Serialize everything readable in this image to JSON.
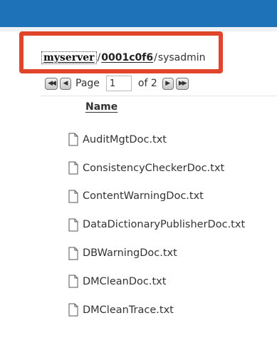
{
  "breadcrumb": {
    "server": "myserver",
    "separator": "/",
    "folder": "0001c0f6",
    "current": "sysadmin"
  },
  "pager": {
    "page_label": "Page",
    "page_value": "1",
    "of_text": "of 2"
  },
  "table": {
    "column_header": "Name",
    "files": [
      "AuditMgtDoc.txt",
      "ConsistencyCheckerDoc.txt",
      "ContentWarningDoc.txt",
      "DataDictionaryPublisherDoc.txt",
      "DBWarningDoc.txt",
      "DMCleanDoc.txt",
      "DMCleanTrace.txt"
    ]
  },
  "colors": {
    "header_bar": "#1d72b8",
    "highlight_border": "#e0452b"
  },
  "icons": {
    "first": "first-page-icon",
    "prev": "previous-page-icon",
    "next": "next-page-icon",
    "last": "last-page-icon",
    "file": "document-icon"
  }
}
